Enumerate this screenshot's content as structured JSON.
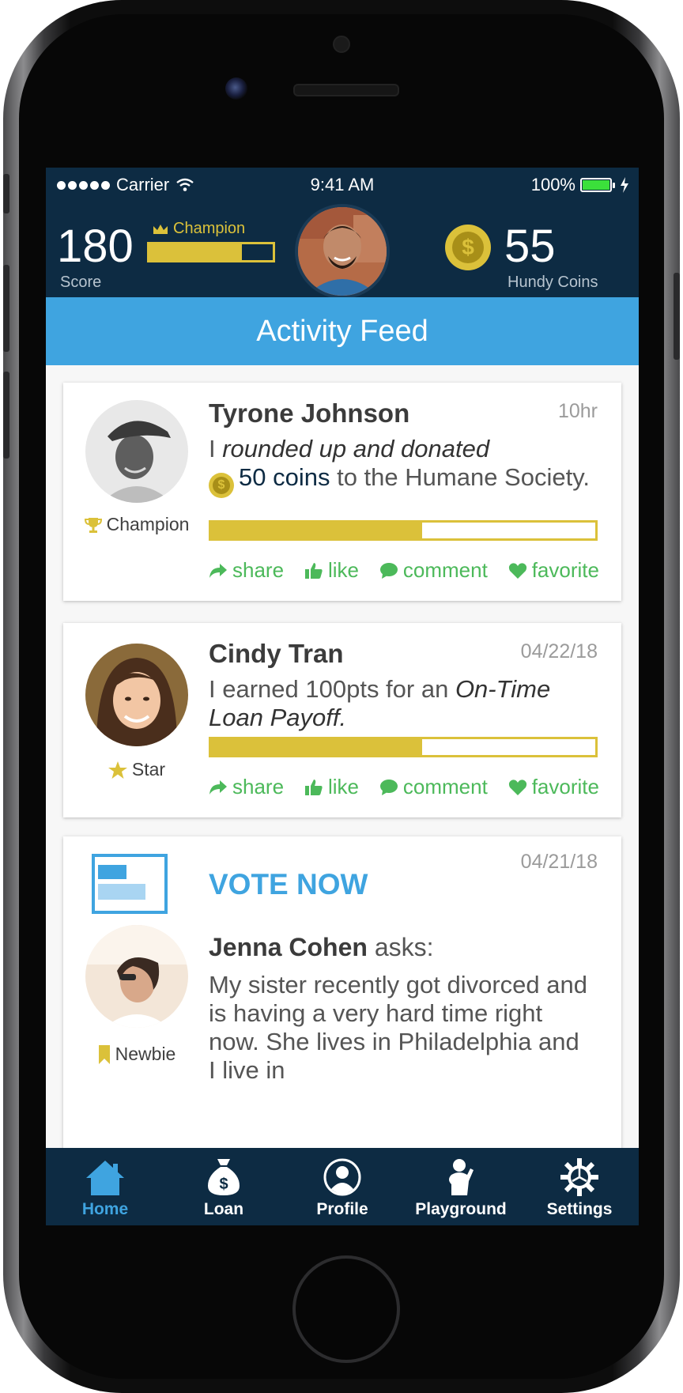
{
  "status_bar": {
    "carrier": "Carrier",
    "time": "9:41 AM",
    "battery": "100%"
  },
  "header": {
    "score_value": "180",
    "score_label": "Score",
    "rank_label": "Champion",
    "rank_progress": 0.75,
    "coins_value": "55",
    "coins_label": "Hundy Coins"
  },
  "title": "Activity Feed",
  "feed": [
    {
      "name": "Tyrone Johnson",
      "time": "10hr",
      "badge": "Champion",
      "msg_pre": "I ",
      "msg_italic": "rounded up and donated",
      "msg_coins": "50 coins",
      "msg_post": " to the Humane Society.",
      "progress": 0.55,
      "actions": [
        "share",
        "like",
        "comment",
        "favorite"
      ]
    },
    {
      "name": "Cindy Tran",
      "time": "04/22/18",
      "badge": "Star",
      "msg_pre": "I earned 100pts for an ",
      "msg_italic": "On-Time Loan Payoff.",
      "progress": 0.55,
      "actions": [
        "share",
        "like",
        "comment",
        "favorite"
      ]
    },
    {
      "vote_title": "VOTE NOW",
      "time": "04/21/18",
      "name": "Jenna Cohen",
      "asks": " asks:",
      "badge": "Newbie",
      "question": "My sister recently got divorced and is having a very hard time right now. She lives in Philadelphia and I live in"
    }
  ],
  "tabs": [
    {
      "label": "Home",
      "icon": "home-icon",
      "active": true
    },
    {
      "label": "Loan",
      "icon": "money-bag-icon"
    },
    {
      "label": "Profile",
      "icon": "profile-icon"
    },
    {
      "label": "Playground",
      "icon": "playground-icon"
    },
    {
      "label": "Settings",
      "icon": "gear-icon"
    }
  ],
  "colors": {
    "navy": "#0d2b43",
    "blue": "#3fa4e0",
    "gold": "#dbc13a",
    "green": "#4cb95a"
  }
}
